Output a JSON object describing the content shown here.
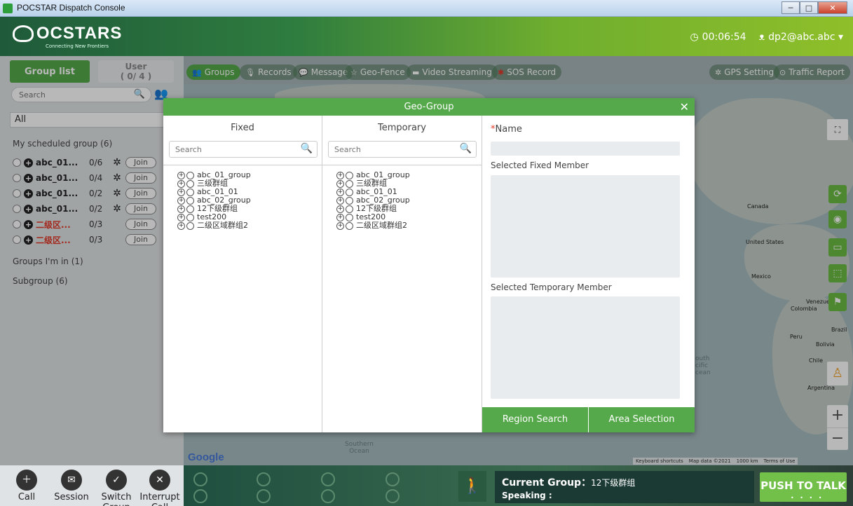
{
  "window": {
    "title": "POCSTAR Dispatch Console",
    "min": "─",
    "max": "□",
    "close": "✕"
  },
  "header": {
    "brand": "OCSTARS",
    "tagline": "Connecting New Frontiers",
    "timer": "00:06:54",
    "timer_icon": "clock-icon",
    "user": "dp2@abc.abc ▾",
    "user_icon": "person-icon"
  },
  "left": {
    "tab_group": "Group list",
    "tab_user_line1": "User",
    "tab_user_line2": "( 0/ 4 )",
    "search_placeholder": "Search",
    "filter": "All",
    "scheduled_label": "My scheduled group (6)",
    "groups": [
      {
        "name": "abc_01...",
        "count": "0/6",
        "has_gear": true,
        "red": false,
        "join": "Join"
      },
      {
        "name": "abc_01...",
        "count": "0/4",
        "has_gear": true,
        "red": false,
        "join": "Join"
      },
      {
        "name": "abc_01...",
        "count": "0/2",
        "has_gear": true,
        "red": false,
        "join": "Join"
      },
      {
        "name": "abc_01...",
        "count": "0/2",
        "has_gear": true,
        "red": false,
        "join": "Join"
      },
      {
        "name": "二级区...",
        "count": "0/3",
        "has_gear": false,
        "red": true,
        "join": "Join"
      },
      {
        "name": "二级区...",
        "count": "0/3",
        "has_gear": false,
        "red": true,
        "join": "Join"
      }
    ],
    "groups_in_label": "Groups I'm in (1)",
    "subgroup_label": "Subgroup (6)"
  },
  "nav": {
    "items": [
      "Groups",
      "Records",
      "Message",
      "Geo-Fence",
      "Video Streaming",
      "SOS Record"
    ],
    "right_items": [
      "GPS Setting",
      "Traffic Report"
    ]
  },
  "map": {
    "labels": [
      "Canada",
      "United States",
      "Mexico",
      "Venezue",
      "Colombia",
      "Brazil",
      "Peru",
      "Bolivia",
      "Chile",
      "Argentina"
    ],
    "ocean_south": "Southern\nOcean",
    "ocean_pacific": "outh\ncific\ncean",
    "google": "Google",
    "attrib": [
      "Keyboard shortcuts",
      "Map data ©2021",
      "1000 km",
      "Terms of Use"
    ]
  },
  "modal": {
    "title": "Geo-Group",
    "close": "✕",
    "fixed_title": "Fixed",
    "temp_title": "Temporary",
    "search_placeholder": "Search",
    "fixed_items": [
      "abc_01_group",
      "三级群组",
      "abc_01_01",
      "abc_02_group",
      "12下级群组",
      "test200",
      "二级区域群组2"
    ],
    "temp_items": [
      "abc_01_group",
      "三级群组",
      "abc_01_01",
      "abc_02_group",
      "12下级群组",
      "test200",
      "二级区域群组2"
    ],
    "name_label": "Name",
    "name_required": "*",
    "name_value": "",
    "sel_fixed_label": "Selected Fixed Member",
    "sel_temp_label": "Selected Temporary Member",
    "btn_region": "Region Search",
    "btn_area": "Area Selection"
  },
  "bottom": {
    "call": "Call",
    "session": "Session",
    "switch_group": "Switch Group",
    "interrupt_call": "Interrupt Call",
    "current_group_label": "Current Group：",
    "current_group_value": "12下级群组",
    "speaking_label": "Speaking :",
    "ptt": "PUSH TO TALK",
    "ptt_dots": "• • • •"
  },
  "colors": {
    "accent": "#55a94a",
    "header_dark": "#1f5a3a",
    "alert": "#e23a2a"
  }
}
